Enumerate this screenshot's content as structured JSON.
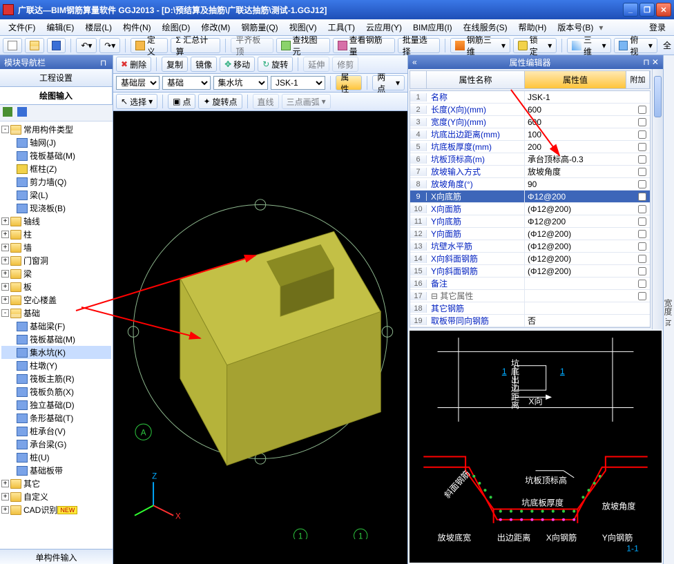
{
  "titlebar": {
    "text": "广联达—BIM钢筋算量软件 GGJ2013 - [D:\\预结算及抽筋\\广联达抽筋\\测试-1.GGJ12]"
  },
  "menu": {
    "items": [
      "文件(F)",
      "编辑(E)",
      "楼层(L)",
      "构件(N)",
      "绘图(D)",
      "修改(M)",
      "钢筋量(Q)",
      "视图(V)",
      "工具(T)",
      "云应用(Y)",
      "BIM应用(I)",
      "在线服务(S)",
      "帮助(H)",
      "版本号(B)"
    ],
    "login": "登录"
  },
  "toolbar1": {
    "define": "定义",
    "sum": "Σ 汇总计算",
    "flat": "平齐板顶",
    "find": "查找图元",
    "findrebar": "查看钢筋量",
    "batchsel": "批量选择",
    "tri": "钢筋三维",
    "lock": "锁定",
    "view3d": "三维",
    "view_ortho": "俯视"
  },
  "centerbar1": {
    "del": "删除",
    "copy": "复制",
    "mirror": "镜像",
    "move": "移动",
    "rotate": "旋转",
    "extend": "延伸",
    "trim": "修剪"
  },
  "centerbar2": {
    "layer": "基础层",
    "cat": "基础",
    "sub": "集水坑",
    "item": "JSK-1",
    "prop": "属性",
    "twopt": "两点"
  },
  "centerbar3": {
    "select": "选择",
    "point": "点",
    "rotpoint": "旋转点",
    "line": "直线",
    "arc3": "三点画弧"
  },
  "left": {
    "title": "模块导航栏",
    "tab1": "工程设置",
    "tab2": "绘图输入",
    "root": "常用构件类型",
    "root_children": [
      "轴网(J)",
      "筏板基础(M)",
      "框柱(Z)",
      "剪力墙(Q)",
      "梁(L)",
      "现浇板(B)"
    ],
    "cats": [
      "轴线",
      "柱",
      "墙",
      "门窗洞",
      "梁",
      "板",
      "空心楼盖"
    ],
    "jichu": "基础",
    "jichu_children": [
      "基础梁(F)",
      "筏板基础(M)",
      "集水坑(K)",
      "柱墩(Y)",
      "筏板主筋(R)",
      "筏板负筋(X)",
      "独立基础(D)",
      "条形基础(T)",
      "桩承台(V)",
      "承台梁(G)",
      "桩(U)",
      "基础板带"
    ],
    "tail": [
      "其它",
      "自定义",
      "CAD识别"
    ],
    "newbadge": "NEW",
    "bottom": "单构件输入"
  },
  "prop": {
    "title": "属性编辑器",
    "col_name": "属性名称",
    "col_val": "属性值",
    "col_add": "附加",
    "rows": [
      {
        "n": 1,
        "name": "名称",
        "val": "JSK-1",
        "chk": false,
        "nocb": true
      },
      {
        "n": 2,
        "name": "长度(X向)(mm)",
        "val": "600",
        "chk": false
      },
      {
        "n": 3,
        "name": "宽度(Y向)(mm)",
        "val": "600",
        "chk": false
      },
      {
        "n": 4,
        "name": "坑底出边距离(mm)",
        "val": "100",
        "chk": false
      },
      {
        "n": 5,
        "name": "坑底板厚度(mm)",
        "val": "200",
        "chk": false
      },
      {
        "n": 6,
        "name": "坑板顶标高(m)",
        "val": "承台顶标高-0.3",
        "chk": false
      },
      {
        "n": 7,
        "name": "放坡输入方式",
        "val": "放坡角度",
        "chk": false
      },
      {
        "n": 8,
        "name": "放坡角度(°)",
        "val": "90",
        "chk": false
      },
      {
        "n": 9,
        "name": "X向底筋",
        "val": "Φ12@200",
        "chk": false,
        "sel": true
      },
      {
        "n": 10,
        "name": "X向面筋",
        "val": "(Φ12@200)",
        "chk": false
      },
      {
        "n": 11,
        "name": "Y向底筋",
        "val": "Φ12@200",
        "chk": false
      },
      {
        "n": 12,
        "name": "Y向面筋",
        "val": "(Φ12@200)",
        "chk": false
      },
      {
        "n": 13,
        "name": "坑壁水平筋",
        "val": "(Φ12@200)",
        "chk": false
      },
      {
        "n": 14,
        "name": "X向斜面钢筋",
        "val": "(Φ12@200)",
        "chk": false
      },
      {
        "n": 15,
        "name": "Y向斜面钢筋",
        "val": "(Φ12@200)",
        "chk": false
      },
      {
        "n": 16,
        "name": "备注",
        "val": "",
        "chk": false
      },
      {
        "n": 17,
        "name": "其它属性",
        "val": "",
        "chk": false,
        "caption": true
      },
      {
        "n": 18,
        "name": "  其它钢筋",
        "val": "",
        "chk": false,
        "nocb": true
      },
      {
        "n": 19,
        "name": "  取板带同向钢筋",
        "val": "否",
        "chk": false,
        "nocb": true
      }
    ]
  },
  "diagram": {
    "labels": {
      "xarrow": "X向",
      "one_a": "1",
      "one_b": "1",
      "kengban": "坑板顶标高",
      "kengdi": "坑底板厚度",
      "fangpo": "放坡角度",
      "ygang": "Y向钢筋",
      "xgang": "X向钢筋",
      "fangpokuan": "放坡底宽",
      "chubian": "出边距离",
      "section": "1-1",
      "xiemian": "斜面钢筋",
      "chubiandim": "坑底出边距离"
    }
  },
  "sidechar": "宽度"
}
